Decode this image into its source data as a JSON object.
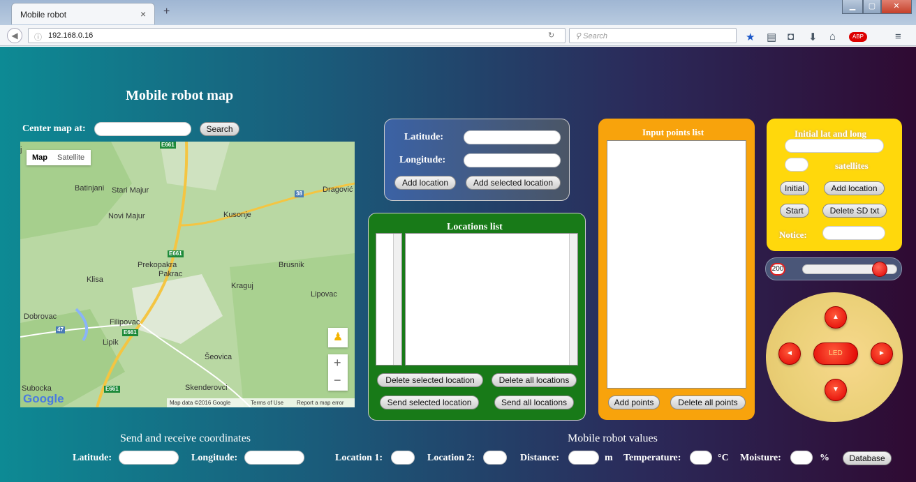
{
  "browser": {
    "tab_title": "Mobile robot",
    "tab_close": "×",
    "new_tab": "+",
    "url": "192.168.0.16",
    "search_placeholder": "Search",
    "icons": [
      "info-icon",
      "reload-icon",
      "search-icon",
      "bookmark-star-icon",
      "reading-list-icon",
      "pocket-icon",
      "download-icon",
      "home-icon",
      "adblock-icon",
      "menu-icon"
    ]
  },
  "page": {
    "map_title": "Mobile robot map",
    "center_label": "Center map at:",
    "center_value": "",
    "search_button": "Search"
  },
  "map": {
    "type_map": "Map",
    "type_satellite": "Satellite",
    "places": {
      "batinjani": "Batinjani",
      "stari_majur": "Stari Majur",
      "dragovic": "Dragović",
      "novi_majur": "Novi Majur",
      "kusonje": "Kusonje",
      "prekopakra": "Prekopakra",
      "pakrac": "Pakrac",
      "brusnik": "Brusnik",
      "klisa": "Klisa",
      "kraguj": "Kraguj",
      "lipovac": "Lipovac",
      "dobrovac": "Dobrovac",
      "filipovac": "Filipovac",
      "lipik": "Lipik",
      "seovica": "Šeovica",
      "subocka": "Subocka",
      "skenderovci": "Skenderovci",
      "edge_j": "j"
    },
    "roads": {
      "e661_top": "E661",
      "r38": "38",
      "e661_mid": "E661",
      "r47": "47",
      "e661_low": "E661",
      "e661_bottom": "E661"
    },
    "zoom_in": "+",
    "zoom_out": "−",
    "logo": "Google",
    "attribution": {
      "data": "Map data ©2016 Google",
      "terms": "Terms of Use",
      "report": "Report a map error"
    }
  },
  "latlng_panel": {
    "latitude_label": "Latitude:",
    "latitude_value": "",
    "longitude_label": "Longitude:",
    "longitude_value": "",
    "add_location": "Add location",
    "add_selected_location": "Add selected location"
  },
  "locations_panel": {
    "title": "Locations list",
    "delete_selected": "Delete selected location",
    "delete_all": "Delete all locations",
    "send_selected": "Send selected location",
    "send_all": "Send all locations"
  },
  "input_points_panel": {
    "title": "Input points list",
    "add_points": "Add points",
    "delete_all_points": "Delete all points"
  },
  "init_panel": {
    "title": "Initial lat and long",
    "init_value": "",
    "satellites_value": "",
    "satellites_label": "satellites",
    "initial_button": "Initial",
    "add_location_button": "Add location",
    "start_button": "Start",
    "delete_sd_button": "Delete SD txt",
    "notice_label": "Notice:",
    "notice_value": ""
  },
  "speed": {
    "value": "200",
    "slider_level_fraction": 0.88
  },
  "joystick": {
    "up": "▲",
    "down": "▼",
    "left": "◄",
    "right": "►",
    "led": "LED"
  },
  "coords": {
    "title": "Send and receive coordinates",
    "latitude_label": "Latitude:",
    "latitude_value": "",
    "longitude_label": "Longitude:",
    "longitude_value": ""
  },
  "robot_values": {
    "title": "Mobile robot values",
    "location1_label": "Location 1:",
    "location2_label": "Location 2:",
    "distance_label": "Distance:",
    "distance_unit": "m",
    "temperature_label": "Temperature:",
    "temperature_unit": "°C",
    "moisture_label": "Moisture:",
    "moisture_unit": "%",
    "database_button": "Database"
  }
}
